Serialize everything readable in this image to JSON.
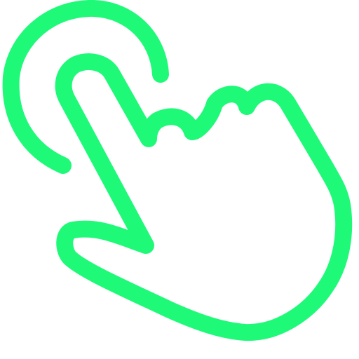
{
  "icon": {
    "name": "tap-gesture-icon",
    "stroke_color": "#1EFA78",
    "background_color": "#ffffff"
  }
}
